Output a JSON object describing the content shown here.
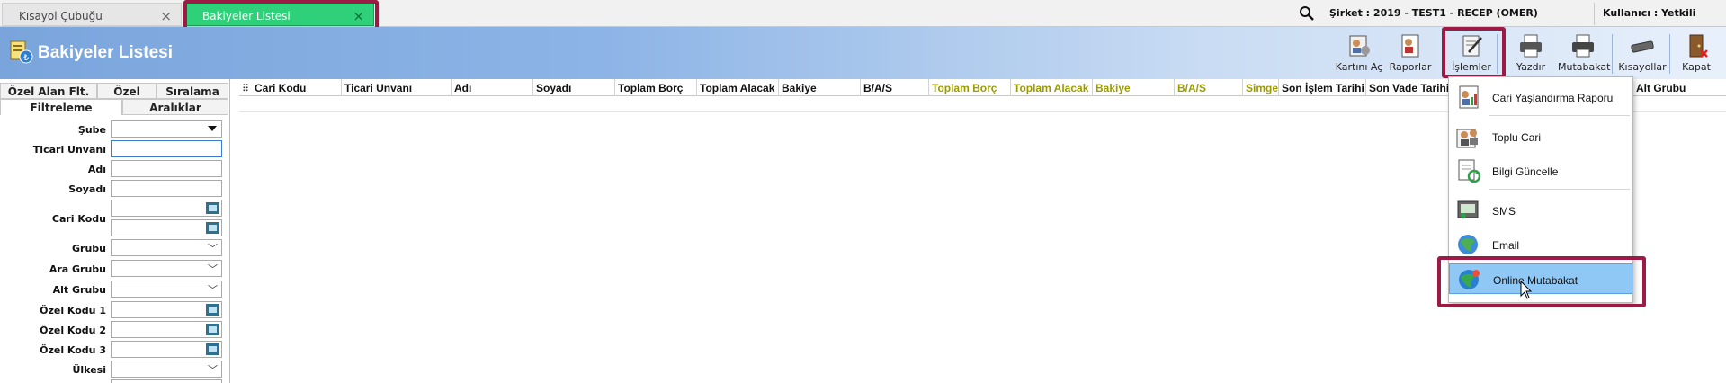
{
  "tabs": [
    {
      "label": "Kısayol Çubuğu",
      "close": "×"
    },
    {
      "label": "Bakiyeler Listesi",
      "close": "×"
    }
  ],
  "topbar": {
    "company": "Şirket : 2019 - TEST1 - RECEP (OMER)",
    "user": "Kullanıcı : Yetkili"
  },
  "header": {
    "title": "Bakiyeler Listesi"
  },
  "toolbar": [
    {
      "label": "Kartını Aç",
      "icon": "open-card-icon"
    },
    {
      "label": "Raporlar",
      "icon": "reports-icon"
    },
    {
      "label": "İşlemler",
      "icon": "operations-icon"
    },
    {
      "label": "Yazdır",
      "icon": "printer-icon"
    },
    {
      "label": "Mutabakat",
      "icon": "reconciliation-printer-icon"
    },
    {
      "label": "Kısayollar",
      "icon": "shortcuts-icon"
    },
    {
      "label": "Kapat",
      "icon": "close-door-icon"
    }
  ],
  "left_tabs": {
    "row1": [
      "Özel Alan Flt.",
      "Özel",
      "Sıralama"
    ],
    "row2": [
      "Filtreleme",
      "Aralıklar"
    ]
  },
  "filters": [
    {
      "label": "Şube",
      "type": "dropdown"
    },
    {
      "label": "Ticari Unvanı",
      "type": "text"
    },
    {
      "label": "Adı",
      "type": "text"
    },
    {
      "label": "Soyadı",
      "type": "text"
    },
    {
      "label": "Cari Kodu",
      "type": "lookup-range"
    },
    {
      "label": "Grubu",
      "type": "select"
    },
    {
      "label": "Ara Grubu",
      "type": "select"
    },
    {
      "label": "Alt Grubu",
      "type": "select"
    },
    {
      "label": "Özel Kodu 1",
      "type": "lookup"
    },
    {
      "label": "Özel Kodu 2",
      "type": "lookup"
    },
    {
      "label": "Özel Kodu 3",
      "type": "lookup"
    },
    {
      "label": "Ülkesi",
      "type": "select"
    }
  ],
  "grid": {
    "columns": [
      "Cari Kodu",
      "Ticari Unvanı",
      "Adı",
      "Soyadı",
      "Toplam Borç",
      "Toplam Alacak",
      "Bakiye",
      "B/A/S",
      "Toplam Borç",
      "Toplam Alacak",
      "Bakiye",
      "B/A/S",
      "Simge",
      "Son İşlem Tarihi",
      "Son Vade Tarihi",
      "Alt Grubu"
    ],
    "grip": "⠿"
  },
  "menu": [
    {
      "label": "Cari Yaşlandırma Raporu",
      "icon": "aging-report-icon"
    },
    {
      "label": "Toplu Cari",
      "icon": "bulk-accounts-icon"
    },
    {
      "label": "Bilgi Güncelle",
      "icon": "update-info-icon"
    },
    {
      "label": "SMS",
      "icon": "sms-icon"
    },
    {
      "label": "Email",
      "icon": "email-icon"
    },
    {
      "label": "Online Mutabakat",
      "icon": "online-reconciliation-icon",
      "selected": true
    }
  ],
  "colors": {
    "active_tab": "#2fd07a",
    "highlight": "#9b1b45",
    "menu_selected": "#8fc7f5",
    "olive_header": "#9b9b00"
  }
}
